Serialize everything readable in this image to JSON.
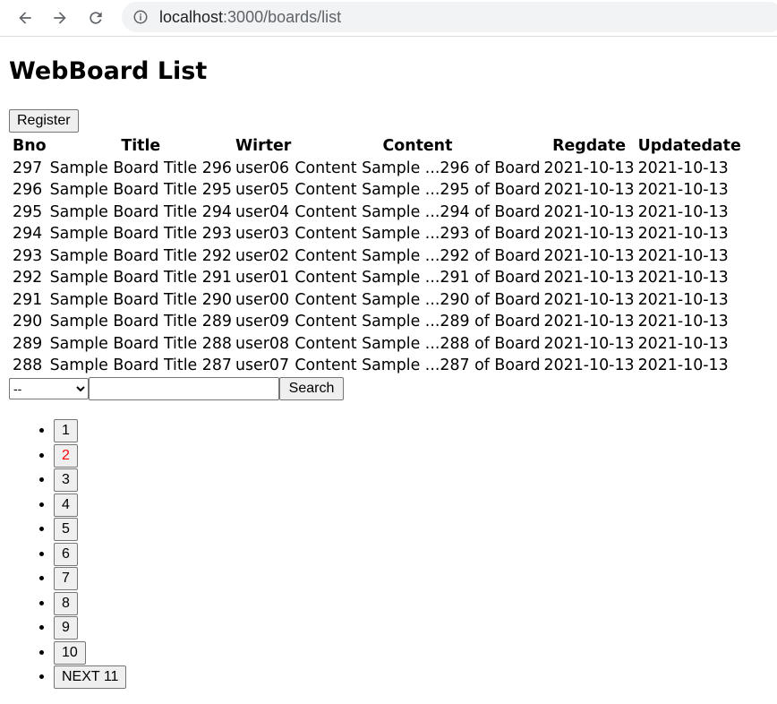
{
  "browser": {
    "url_host": "localhost",
    "url_rest": ":3000/boards/list",
    "back_icon": "arrow-left-icon",
    "forward_icon": "arrow-right-icon",
    "reload_icon": "reload-icon",
    "info_icon": "info-icon"
  },
  "page": {
    "title": "WebBoard List",
    "register_label": "Register"
  },
  "table": {
    "headers": [
      "Bno",
      "Title",
      "Wirter",
      "Content",
      "Regdate",
      "Updatedate"
    ],
    "rows": [
      [
        "297",
        "Sample Board Title 296",
        "user06",
        "Content Sample ...296 of Board",
        "2021-10-13",
        "2021-10-13"
      ],
      [
        "296",
        "Sample Board Title 295",
        "user05",
        "Content Sample ...295 of Board",
        "2021-10-13",
        "2021-10-13"
      ],
      [
        "295",
        "Sample Board Title 294",
        "user04",
        "Content Sample ...294 of Board",
        "2021-10-13",
        "2021-10-13"
      ],
      [
        "294",
        "Sample Board Title 293",
        "user03",
        "Content Sample ...293 of Board",
        "2021-10-13",
        "2021-10-13"
      ],
      [
        "293",
        "Sample Board Title 292",
        "user02",
        "Content Sample ...292 of Board",
        "2021-10-13",
        "2021-10-13"
      ],
      [
        "292",
        "Sample Board Title 291",
        "user01",
        "Content Sample ...291 of Board",
        "2021-10-13",
        "2021-10-13"
      ],
      [
        "291",
        "Sample Board Title 290",
        "user00",
        "Content Sample ...290 of Board",
        "2021-10-13",
        "2021-10-13"
      ],
      [
        "290",
        "Sample Board Title 289",
        "user09",
        "Content Sample ...289 of Board",
        "2021-10-13",
        "2021-10-13"
      ],
      [
        "289",
        "Sample Board Title 288",
        "user08",
        "Content Sample ...288 of Board",
        "2021-10-13",
        "2021-10-13"
      ],
      [
        "288",
        "Sample Board Title 287",
        "user07",
        "Content Sample ...287 of Board",
        "2021-10-13",
        "2021-10-13"
      ]
    ]
  },
  "search": {
    "type_selected": "--",
    "keyword_value": "",
    "button_label": "Search"
  },
  "pagination": {
    "current": "2",
    "current_color": "#ff0000",
    "pages": [
      "1",
      "2",
      "3",
      "4",
      "5",
      "6",
      "7",
      "8",
      "9",
      "10"
    ],
    "next_label": "NEXT 11"
  }
}
